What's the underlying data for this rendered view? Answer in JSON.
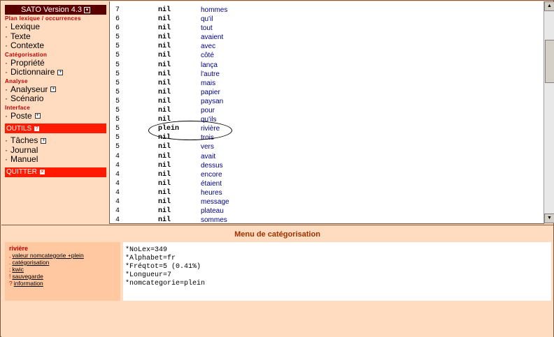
{
  "nav": {
    "title": "SATO Version 4.3",
    "sections": [
      {
        "heading": "Plan lexique / occurrences",
        "items": [
          {
            "label": "Lexique",
            "plus": false
          },
          {
            "label": "Texte",
            "plus": false
          },
          {
            "label": "Contexte",
            "plus": false
          }
        ]
      },
      {
        "heading": "Catégorisation",
        "items": [
          {
            "label": "Propriété",
            "plus": false
          },
          {
            "label": "Dictionnaire",
            "plus": true
          }
        ]
      },
      {
        "heading": "Analyse",
        "items": [
          {
            "label": "Analyseur",
            "plus": true
          },
          {
            "label": "Scénario",
            "plus": false
          }
        ]
      },
      {
        "heading": "Interface",
        "items": [
          {
            "label": "Poste",
            "plus": true
          }
        ]
      }
    ],
    "outils_label": "OUTILS",
    "outils_items": [
      {
        "label": "Tâches",
        "plus": true
      },
      {
        "label": "Journal",
        "plus": false
      },
      {
        "label": "Manuel",
        "plus": false
      }
    ],
    "quitter_label": "QUITTER"
  },
  "lexicon_rows": [
    {
      "freq": "7",
      "cat": "nil",
      "word": "hommes"
    },
    {
      "freq": "6",
      "cat": "nil",
      "word": "qu'il"
    },
    {
      "freq": "6",
      "cat": "nil",
      "word": "tout"
    },
    {
      "freq": "5",
      "cat": "nil",
      "word": "avaient"
    },
    {
      "freq": "5",
      "cat": "nil",
      "word": "avec"
    },
    {
      "freq": "5",
      "cat": "nil",
      "word": "côté"
    },
    {
      "freq": "5",
      "cat": "nil",
      "word": "lança"
    },
    {
      "freq": "5",
      "cat": "nil",
      "word": "l'autre"
    },
    {
      "freq": "5",
      "cat": "nil",
      "word": "mais"
    },
    {
      "freq": "5",
      "cat": "nil",
      "word": "papier"
    },
    {
      "freq": "5",
      "cat": "nil",
      "word": "paysan"
    },
    {
      "freq": "5",
      "cat": "nil",
      "word": "pour"
    },
    {
      "freq": "5",
      "cat": "nil",
      "word": "qu'ils"
    },
    {
      "freq": "5",
      "cat": "plein",
      "word": "rivière"
    },
    {
      "freq": "5",
      "cat": "nil",
      "word": "trois"
    },
    {
      "freq": "5",
      "cat": "nil",
      "word": "vers"
    },
    {
      "freq": "4",
      "cat": "nil",
      "word": "avait"
    },
    {
      "freq": "4",
      "cat": "nil",
      "word": "dessus"
    },
    {
      "freq": "4",
      "cat": "nil",
      "word": "encore"
    },
    {
      "freq": "4",
      "cat": "nil",
      "word": "étaient"
    },
    {
      "freq": "4",
      "cat": "nil",
      "word": "heures"
    },
    {
      "freq": "4",
      "cat": "nil",
      "word": "message"
    },
    {
      "freq": "4",
      "cat": "nil",
      "word": "plateau"
    },
    {
      "freq": "4",
      "cat": "nil",
      "word": "sommes"
    }
  ],
  "bottom": {
    "menu_title": "Menu de catégorisation",
    "selected_word": "rivière",
    "commands": [
      {
        "key": ",",
        "label": "valeur nomcategorie +plein"
      },
      {
        "key": ".",
        "label": "catégorisation"
      },
      {
        "key": ";",
        "label": "kwic"
      },
      {
        "key": "!",
        "label": "sauvegarde"
      },
      {
        "key": "?",
        "label": "information"
      }
    ],
    "info_lines": [
      "*NoLex=349",
      "*Alphabet=fr",
      "*Fréqtot=5 (0.41%)",
      "*Longueur=7",
      "*nomcategorie=plein"
    ]
  },
  "colors": {
    "accent_red": "#ff1a00",
    "title_bar": "#5a0000",
    "peach": "#ffdcc0"
  }
}
